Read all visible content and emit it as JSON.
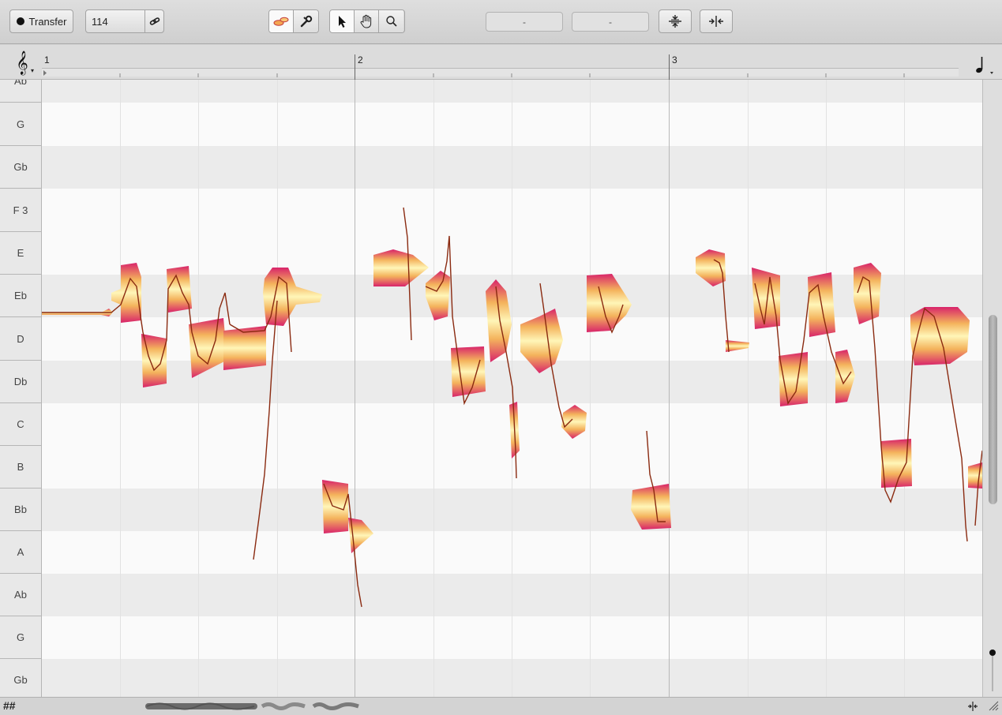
{
  "toolbar": {
    "transfer_label": "Transfer",
    "tempo_value": "114",
    "field_left": "-",
    "field_right": "-",
    "icons": [
      "link-icon",
      "blob-tool-icon",
      "wrench-icon",
      "arrow-pointer-icon",
      "hand-icon",
      "magnifier-icon",
      "pitch-quantize-icon",
      "time-quantize-icon"
    ]
  },
  "ruler": {
    "bars": [
      "1",
      "2",
      "3"
    ]
  },
  "pitches": [
    "Ab",
    "G",
    "Gb",
    "F 3",
    "E",
    "Eb",
    "D",
    "Db",
    "C",
    "B",
    "Bb",
    "A",
    "Ab",
    "G",
    "Gb"
  ],
  "dark_rows": [
    "Ab",
    "Gb",
    "Eb",
    "Db",
    "Bb",
    "Ab",
    "Gb"
  ],
  "bottom": {
    "hash": "##"
  },
  "colors": {
    "blob_core": "#fff6b8",
    "blob_mid": "#f4b35c",
    "blob_edge": "#d8246a",
    "pitch_line": "#8a2a10"
  }
}
